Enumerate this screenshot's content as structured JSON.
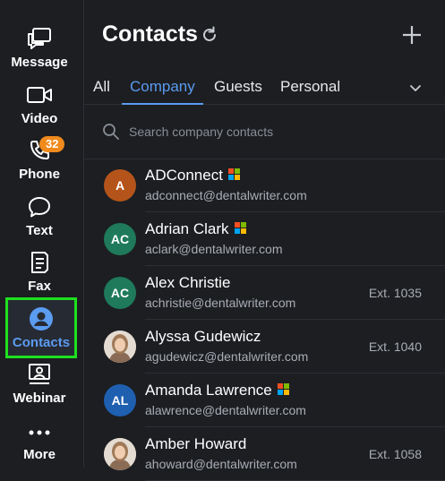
{
  "sidebar": {
    "items": [
      {
        "label": "Message",
        "icon": "message-icon"
      },
      {
        "label": "Video",
        "icon": "video-icon"
      },
      {
        "label": "Phone",
        "icon": "phone-icon",
        "badge": "32"
      },
      {
        "label": "Text",
        "icon": "text-bubble-icon"
      },
      {
        "label": "Fax",
        "icon": "fax-icon"
      },
      {
        "label": "Contacts",
        "icon": "contacts-icon",
        "active": true
      },
      {
        "label": "Webinar",
        "icon": "webinar-icon"
      },
      {
        "label": "More",
        "icon": "more-dots-icon"
      }
    ]
  },
  "header": {
    "title": "Contacts"
  },
  "tabs": [
    {
      "label": "All"
    },
    {
      "label": "Company",
      "active": true
    },
    {
      "label": "Guests"
    },
    {
      "label": "Personal"
    }
  ],
  "search": {
    "placeholder": "Search company contacts"
  },
  "contacts": [
    {
      "name": "ADConnect",
      "email": "adconnect@dentalwriter.com",
      "initials": "A",
      "avatar_color": "#b4541a",
      "ms": true,
      "ext": ""
    },
    {
      "name": "Adrian Clark",
      "email": "aclark@dentalwriter.com",
      "initials": "AC",
      "avatar_color": "#1e7a5a",
      "ms": true,
      "ext": ""
    },
    {
      "name": "Alex Christie",
      "email": "achristie@dentalwriter.com",
      "initials": "AC",
      "avatar_color": "#1e7a5a",
      "ms": false,
      "ext": "Ext. 1035"
    },
    {
      "name": "Alyssa Gudewicz",
      "email": "agudewicz@dentalwriter.com",
      "initials": "",
      "avatar_color": "#c9a78a",
      "ms": false,
      "ext": "Ext. 1040",
      "photo": true
    },
    {
      "name": "Amanda Lawrence",
      "email": "alawrence@dentalwriter.com",
      "initials": "AL",
      "avatar_color": "#1e5fb0",
      "ms": true,
      "ext": ""
    },
    {
      "name": "Amber Howard",
      "email": "ahoward@dentalwriter.com",
      "initials": "",
      "avatar_color": "#d8c0a0",
      "ms": false,
      "ext": "Ext. 1058",
      "photo": true
    }
  ],
  "colors": {
    "accent": "#5b9bf0",
    "badge": "#f08a1c",
    "background": "#1c1e22"
  }
}
